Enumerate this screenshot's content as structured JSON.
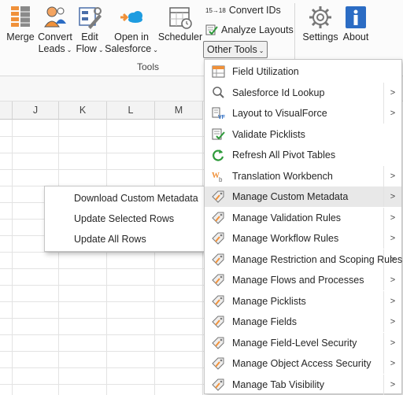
{
  "ribbon": {
    "merge": "Merge",
    "convert_leads_1": "Convert",
    "convert_leads_2": "Leads",
    "edit_flow_1": "Edit",
    "edit_flow_2": "Flow",
    "open_sf_1": "Open in",
    "open_sf_2": "Salesforce",
    "scheduler": "Scheduler",
    "convert_ids_prefix": "15",
    "convert_ids_suffix": "18",
    "convert_ids": "Convert IDs",
    "analyze_layouts": "Analyze Layouts",
    "other_tools": "Other Tools",
    "settings": "Settings",
    "about": "About",
    "group_label": "Tools",
    "chevron": "⌄"
  },
  "columns": [
    "J",
    "K",
    "L",
    "M"
  ],
  "menu": {
    "items": [
      {
        "label": "Field Utilization",
        "icon": "field-utilization-icon",
        "submenu": false
      },
      {
        "label": "Salesforce Id Lookup",
        "icon": "magnifier-icon",
        "submenu": true
      },
      {
        "label": "Layout to VisualForce",
        "icon": "visualforce-icon",
        "submenu": true
      },
      {
        "label": "Validate Picklists",
        "icon": "validate-picklists-icon",
        "submenu": false
      },
      {
        "label": "Refresh All Pivot Tables",
        "icon": "refresh-icon",
        "submenu": false
      },
      {
        "label": "Translation Workbench",
        "icon": "translation-icon",
        "submenu": true
      },
      {
        "label": "Manage Custom Metadata",
        "icon": "tag-icon",
        "submenu": true
      },
      {
        "label": "Manage Validation Rules",
        "icon": "tag-icon",
        "submenu": true
      },
      {
        "label": "Manage Workflow Rules",
        "icon": "tag-icon",
        "submenu": true
      },
      {
        "label": "Manage Restriction and Scoping Rules",
        "icon": "tag-icon",
        "submenu": true
      },
      {
        "label": "Manage Flows and Processes",
        "icon": "tag-icon",
        "submenu": true
      },
      {
        "label": "Manage Picklists",
        "icon": "tag-icon",
        "submenu": true
      },
      {
        "label": "Manage Fields",
        "icon": "tag-icon",
        "submenu": true
      },
      {
        "label": "Manage Field-Level Security",
        "icon": "tag-icon",
        "submenu": true
      },
      {
        "label": "Manage Object Access Security",
        "icon": "tag-icon",
        "submenu": true
      },
      {
        "label": "Manage Tab Visibility",
        "icon": "tag-icon",
        "submenu": true
      }
    ],
    "highlighted_index": 6,
    "arrow_glyph": ">"
  },
  "submenu": {
    "items": [
      "Download Custom Metadata",
      "Update Selected Rows",
      "Update All Rows"
    ]
  }
}
